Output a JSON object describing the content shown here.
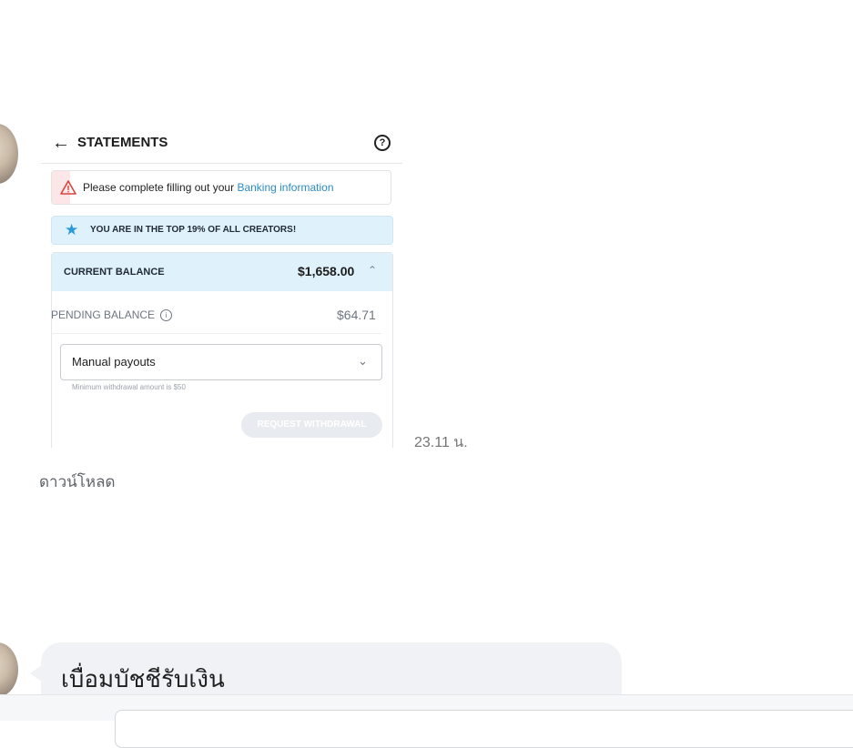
{
  "chat": {
    "time": "23.11 น.",
    "download_label": "ดาวน์โหลด",
    "message_text": "เบื่อมบัชชีรับเงิน"
  },
  "embedded_screenshot": {
    "header_title": "STATEMENTS",
    "warning_text": "Please complete filling out your ",
    "warning_link": "Banking information",
    "top_creators_text": "YOU ARE IN THE TOP 19% OF ALL CREATORS!",
    "current_balance_label": "CURRENT BALANCE",
    "current_balance_value": "$1,658.00",
    "pending_balance_label": "PENDING BALANCE",
    "pending_balance_value": "$64.71",
    "payout_select_value": "Manual payouts",
    "minimum_note": "Minimum withdrawal amount is $50",
    "request_button_label": "REQUEST WITHDRAWAL"
  },
  "icons": {
    "back": "arrow-left-icon",
    "help": "question-circle-icon",
    "warning": "warning-triangle-icon",
    "star": "star-icon",
    "collapse": "chevron-up-icon",
    "info": "info-circle-icon",
    "dropdown": "chevron-down-icon"
  },
  "colors": {
    "link": "#2b8cc4",
    "info_banner_bg": "#dff1fb",
    "warning_strip": "#fde6e8",
    "bubble_bg": "#f0f2f5"
  }
}
